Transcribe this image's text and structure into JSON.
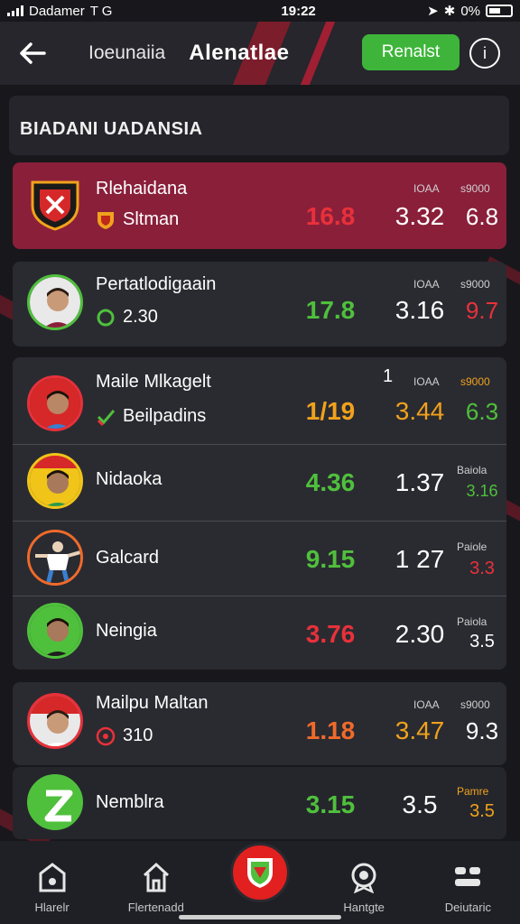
{
  "status_bar": {
    "carrier": "Dadamer",
    "time": "19:22",
    "battery": "0%",
    "extra": "T G"
  },
  "header": {
    "subtitle": "Ioeunaiia",
    "brand": "Alenatlae",
    "refresh_label": "Renalst",
    "info_label": "i"
  },
  "section": {
    "title": "BIADANI UADANSIA"
  },
  "rows": [
    {
      "name": "Rlehaidana",
      "sub_text": "Sltman",
      "sub_icon": "shield-icon",
      "col_header_a": "IOAA",
      "col_header_b": "s9000",
      "stat_main": "16.8",
      "stat_2": "3.32",
      "stat_3": "6.8",
      "color_main": "#e8313a",
      "color_3": "#ffffff"
    },
    {
      "name": "Pertatlodigaain",
      "sub_text": "2.30",
      "sub_icon": "coin-icon",
      "col_header_a": "IOAA",
      "col_header_b": "s9000",
      "stat_main": "17.8",
      "stat_2": "3.16",
      "stat_3": "9.7",
      "color_main": "#4fc03c",
      "color_3": "#e8313a"
    },
    {
      "name": "Maile Mlkagelt",
      "sub_text": "Beilpadins",
      "sub_icon": "check-icon",
      "col_header_marker": "1",
      "col_header_a": "IOAA",
      "col_header_b": "s9000",
      "stat_main": "1/19",
      "stat_2": "3.44",
      "stat_3": "6.3",
      "color_main": "#f0a21c",
      "color_3": "#4fc03c"
    },
    {
      "name": "Nidaoka",
      "col_header_b": "Baiola",
      "stat_main": "4.36",
      "stat_2": "1.37",
      "stat_3": "3.16",
      "color_main": "#4fc03c",
      "color_3": "#4fc03c"
    },
    {
      "name": "Galcard",
      "col_header_b": "Paiole",
      "stat_main": "9.15",
      "stat_2": "1 27",
      "stat_3": "3.3",
      "color_main": "#4fc03c",
      "color_3": "#e8313a"
    },
    {
      "name": "Neingia",
      "col_header_b": "Paiola",
      "stat_main": "3.76",
      "stat_2": "2.30",
      "stat_3": "3.5",
      "color_main": "#e8313a",
      "color_3": "#ffffff"
    },
    {
      "name": "Mailpu Maltan",
      "sub_text": "310",
      "sub_icon": "target-icon",
      "col_header_a": "IOAA",
      "col_header_b": "s9000",
      "stat_main": "1.18",
      "stat_2": "3.47",
      "stat_3": "9.3",
      "color_main": "#f06a2a",
      "color_3": "#ffffff"
    },
    {
      "name": "Nemblra",
      "col_header_b": "Pamre",
      "stat_main": "3.15",
      "stat_2": "3.5",
      "stat_3": "3.5",
      "color_main": "#4fc03c",
      "color_3": "#f0a21c"
    }
  ],
  "bottom_nav": [
    {
      "label": "Hlarelr",
      "icon": "home-icon"
    },
    {
      "label": "Flertenadd",
      "icon": "house-outline-icon"
    },
    {
      "label": "",
      "icon": "shield-emblem-icon"
    },
    {
      "label": "Hantgte",
      "icon": "badge-icon"
    },
    {
      "label": "Deiutaric",
      "icon": "grid-icon"
    }
  ],
  "colors": {
    "accent_green": "#3eb53a",
    "accent_red": "#e1201f",
    "highlight_row": "#8a1f3a",
    "background": "#18181c"
  }
}
